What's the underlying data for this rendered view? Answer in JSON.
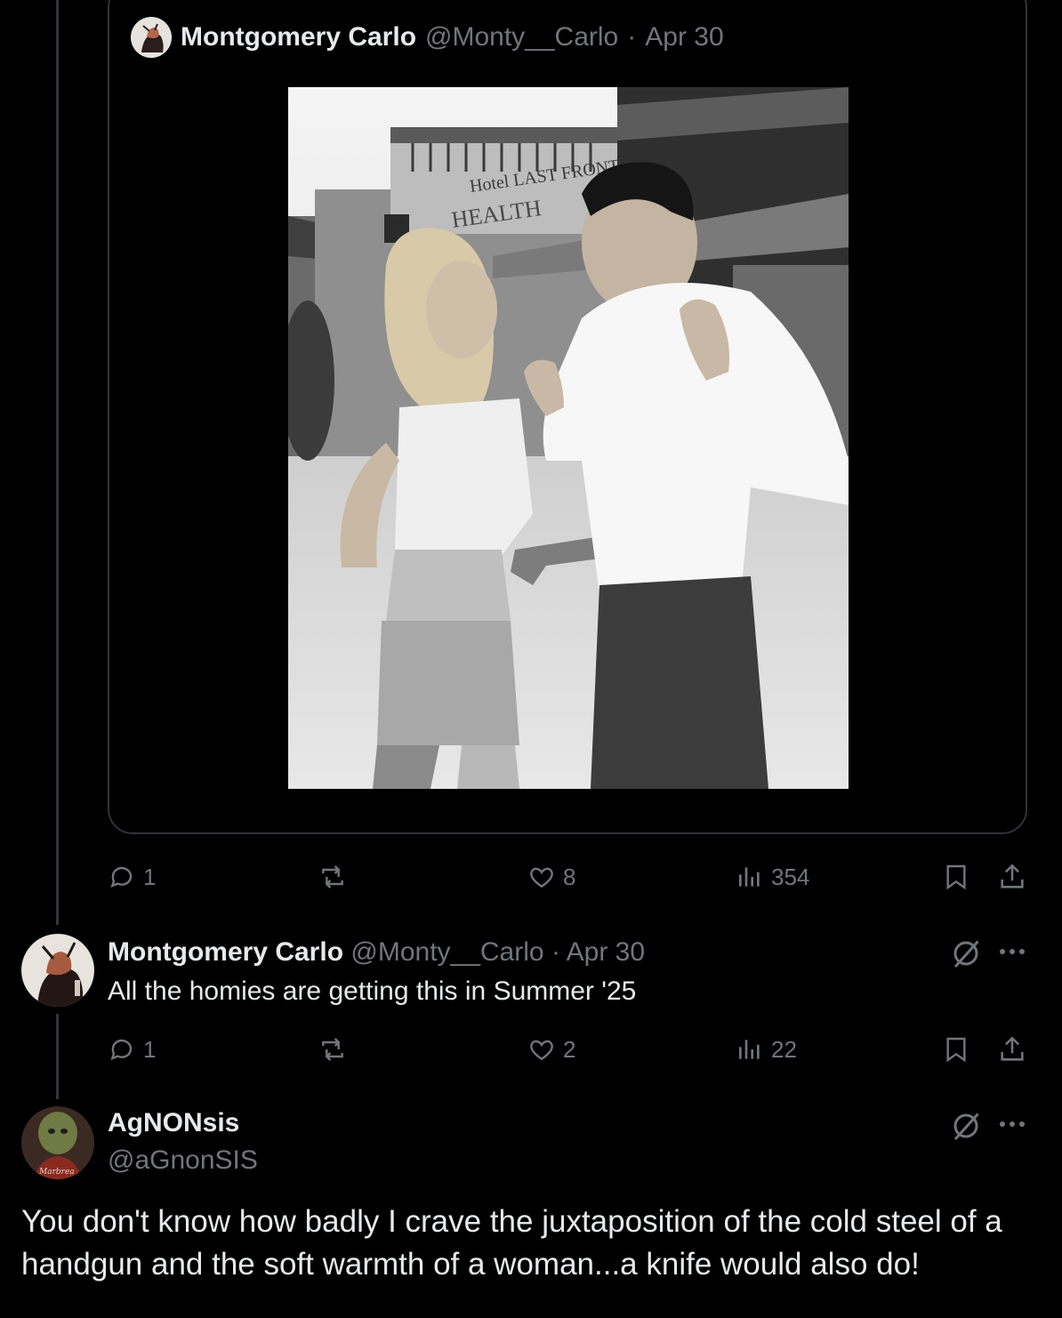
{
  "quoted_tweet": {
    "author_name": "Montgomery Carlo",
    "author_handle": "@Monty__Carlo",
    "separator": "·",
    "date": "Apr 30",
    "photo_sign_line1": "Hotel LAST FRONT",
    "photo_sign_line2": "HEALTH"
  },
  "main_tweet_actions": {
    "replies": "1",
    "reposts": "",
    "likes": "8",
    "views": "354"
  },
  "reply": {
    "author_name": "Montgomery Carlo",
    "author_handle": "@Monty__Carlo",
    "separator": "·",
    "date": "Apr 30",
    "text": "All the homies are getting this in Summer '25",
    "actions": {
      "replies": "1",
      "reposts": "",
      "likes": "2",
      "views": "22"
    }
  },
  "focused_tweet": {
    "author_name": "AgNONsis",
    "author_handle": "@aGnonSIS",
    "text": "You don't know how badly I crave the juxtaposition of the cold steel of a handgun and the soft warmth of a woman...a knife would also do!",
    "avatar_caption": "Marbrea"
  },
  "icons": {
    "reply": "reply-icon",
    "repost": "repost-icon",
    "like": "heart-icon",
    "views": "views-icon",
    "bookmark": "bookmark-icon",
    "share": "share-icon",
    "grok": "grok-icon",
    "more": "more-icon"
  },
  "colors": {
    "background": "#000000",
    "text": "#e7e9ea",
    "muted": "#71767b",
    "border": "#2f3336"
  }
}
